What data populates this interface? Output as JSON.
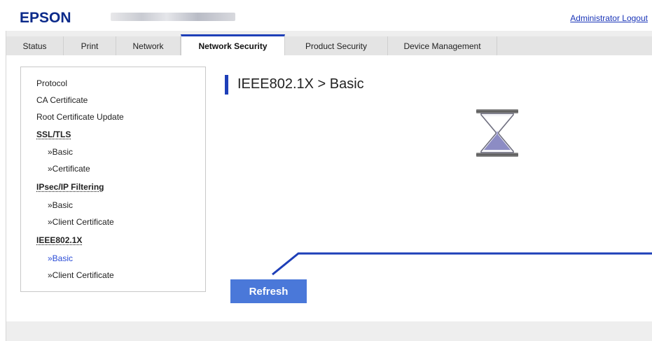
{
  "header": {
    "logo": "EPSON",
    "admin_logout": "Administrator Logout"
  },
  "tabs": [
    {
      "label": "Status",
      "active": false
    },
    {
      "label": "Print",
      "active": false
    },
    {
      "label": "Network",
      "active": false
    },
    {
      "label": "Network Security",
      "active": true
    },
    {
      "label": "Product Security",
      "active": false
    },
    {
      "label": "Device Management",
      "active": false
    }
  ],
  "sidebar": {
    "items": [
      {
        "label": "Protocol",
        "kind": "link"
      },
      {
        "label": "CA Certificate",
        "kind": "link"
      },
      {
        "label": "Root Certificate Update",
        "kind": "link"
      },
      {
        "label": "SSL/TLS",
        "kind": "heading"
      },
      {
        "label": "»Basic",
        "kind": "sub"
      },
      {
        "label": "»Certificate",
        "kind": "sub"
      },
      {
        "label": "IPsec/IP Filtering",
        "kind": "heading"
      },
      {
        "label": "»Basic",
        "kind": "sub"
      },
      {
        "label": "»Client Certificate",
        "kind": "sub"
      },
      {
        "label": "IEEE802.1X",
        "kind": "heading"
      },
      {
        "label": "»Basic",
        "kind": "sub-current"
      },
      {
        "label": "»Client Certificate",
        "kind": "sub"
      }
    ]
  },
  "main": {
    "title": "IEEE802.1X > Basic",
    "loading_icon": "hourglass-icon",
    "refresh_label": "Refresh"
  },
  "colors": {
    "brand_blue": "#0b2a8a",
    "accent_blue": "#1e3fb8",
    "button_blue": "#4a78d9",
    "link_blue": "#1a35b8",
    "current_item": "#2a4bd6"
  }
}
